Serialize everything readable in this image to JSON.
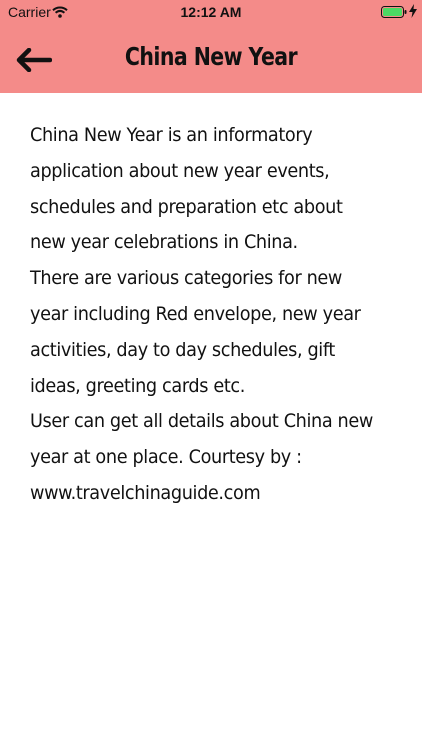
{
  "status_bar": {
    "carrier": "Carrier",
    "time": "12:12 AM",
    "wifi_icon": "wifi-icon",
    "battery_icon": "battery-icon",
    "charging_icon": "charging-bolt-icon",
    "battery_color": "#4cd964"
  },
  "nav_bar": {
    "back_icon": "back-arrow-icon",
    "title": "China New Year",
    "background_color": "#f48b89"
  },
  "content": {
    "description": " China New Year is an informatory\napplication about new year events,\nschedules and preparation etc about\nnew year celebrations in China.\nThere are various categories for new\nyear including Red envelope, new year\nactivities, day to day schedules, gift\nideas, greeting cards etc.\nUser can get all details about China new\nyear at one place.  Courtesy by :\nwww.travelchinaguide.com"
  }
}
